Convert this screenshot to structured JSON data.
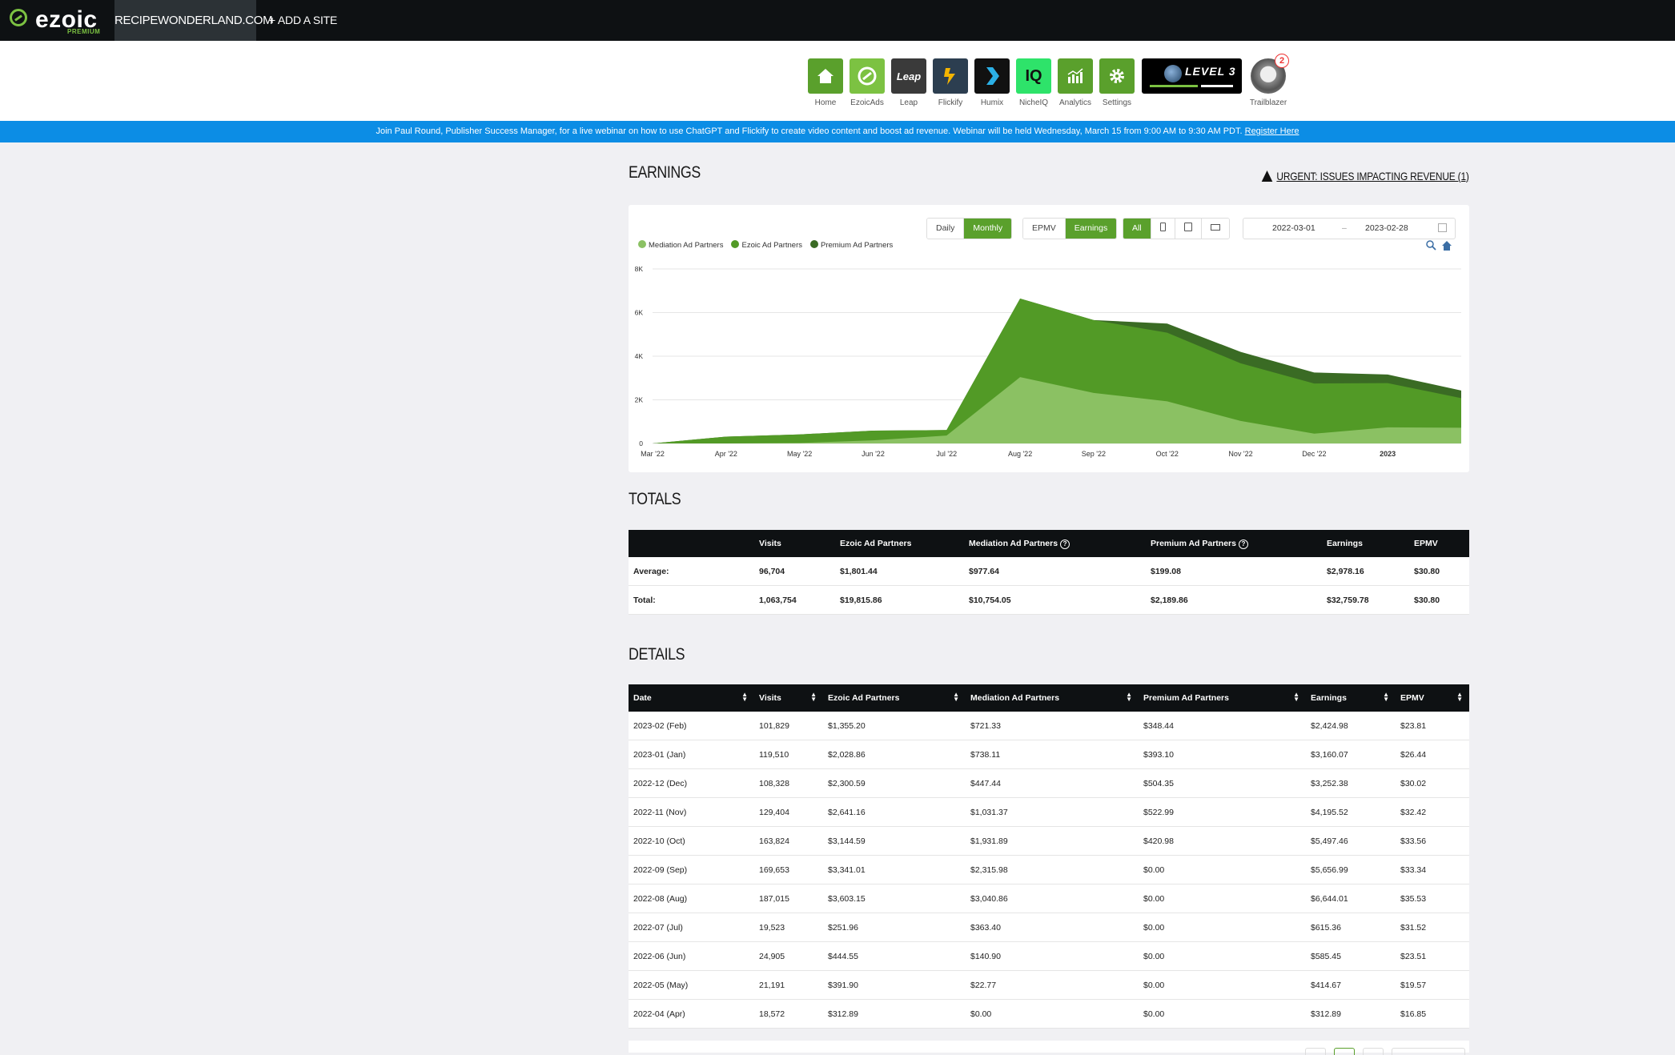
{
  "topbar": {
    "logo_text": "ezoic",
    "logo_tag": "PREMIUM",
    "site": "RECIPEWONDERLAND.COM",
    "add_site": "+ ADD A SITE"
  },
  "apps": [
    {
      "label": "Home",
      "icon": "house-icon",
      "color": "#5aa02c"
    },
    {
      "label": "EzoicAds",
      "icon": "ezoic-ads-icon",
      "color": "#7cc242"
    },
    {
      "label": "Leap",
      "icon": "leap-icon",
      "color": "#3a3a3a",
      "text": "Leap"
    },
    {
      "label": "Flickify",
      "icon": "flickify-icon",
      "color": "#2c3e50"
    },
    {
      "label": "Humix",
      "icon": "humix-icon",
      "color": "#111"
    },
    {
      "label": "NicheIQ",
      "icon": "nicheiq-icon",
      "color": "#2ee36a",
      "text": "IQ"
    },
    {
      "label": "Analytics",
      "icon": "analytics-icon",
      "color": "#5aa02c"
    },
    {
      "label": "Settings",
      "icon": "gear-icon",
      "color": "#5aa02c"
    }
  ],
  "level": "LEVEL 3",
  "trailblazer": {
    "label": "Trailblazer",
    "badge": "2"
  },
  "banner": {
    "text": "Join Paul Round, Publisher Success Manager, for a live webinar on how to use ChatGPT and Flickify to create video content and boost ad revenue. Webinar will be held Wednesday, March 15 from 9:00 AM to 9:30 AM PDT.",
    "link": "Register Here"
  },
  "earnings": {
    "title": "EARNINGS",
    "urgent": "URGENT: ISSUES IMPACTING REVENUE (1)",
    "period_buttons": [
      "Daily",
      "Monthly"
    ],
    "metric_buttons": [
      "EPMV",
      "Earnings"
    ],
    "device_all": "All",
    "date_from": "2022-03-01",
    "date_sep": "–",
    "date_to": "2023-02-28"
  },
  "chart_data": {
    "type": "area",
    "stacked": true,
    "categories": [
      "Mar '22",
      "Apr '22",
      "May '22",
      "Jun '22",
      "Jul '22",
      "Aug '22",
      "Sep '22",
      "Oct '22",
      "Nov '22",
      "Dec '22",
      "2023",
      ""
    ],
    "x_tick_labels": [
      "Mar '22",
      "Apr '22",
      "May '22",
      "Jun '22",
      "Jul '22",
      "Aug '22",
      "Sep '22",
      "Oct '22",
      "Nov '22",
      "Dec '22",
      "2023"
    ],
    "y_ticks": [
      "0",
      "2K",
      "4K",
      "6K",
      "8K"
    ],
    "ylim": [
      0,
      8000
    ],
    "series": [
      {
        "name": "Mediation Ad Partners",
        "color": "#8bc163",
        "values": [
          0,
          0,
          22.77,
          140.9,
          363.4,
          3040.86,
          2315.98,
          1931.89,
          1031.37,
          447.44,
          738.11,
          721.33
        ]
      },
      {
        "name": "Ezoic Ad Partners",
        "color": "#529a26",
        "values": [
          0,
          312.89,
          391.9,
          444.55,
          251.96,
          3603.15,
          3341.01,
          3144.59,
          2641.16,
          2300.59,
          2028.86,
          1355.2
        ]
      },
      {
        "name": "Premium Ad Partners",
        "color": "#3a6b24",
        "values": [
          0,
          0,
          0,
          0,
          0,
          0,
          0,
          420.98,
          522.99,
          504.35,
          393.1,
          348.44
        ]
      }
    ],
    "legend_position": "top-left",
    "grid": true
  },
  "totals": {
    "title": "TOTALS",
    "headers": [
      "",
      "Visits",
      "Ezoic Ad Partners",
      "Mediation Ad Partners",
      "Premium Ad Partners",
      "Earnings",
      "EPMV"
    ],
    "rows": [
      [
        "Average:",
        "96,704",
        "$1,801.44",
        "$977.64",
        "$199.08",
        "$2,978.16",
        "$30.80"
      ],
      [
        "Total:",
        "1,063,754",
        "$19,815.86",
        "$10,754.05",
        "$2,189.86",
        "$32,759.78",
        "$30.80"
      ]
    ]
  },
  "details": {
    "title": "DETAILS",
    "headers": [
      "Date",
      "Visits",
      "Ezoic Ad Partners",
      "Mediation Ad Partners",
      "Premium Ad Partners",
      "Earnings",
      "EPMV"
    ],
    "rows": [
      [
        "2023-02 (Feb)",
        "101,829",
        "$1,355.20",
        "$721.33",
        "$348.44",
        "$2,424.98",
        "$23.81"
      ],
      [
        "2023-01 (Jan)",
        "119,510",
        "$2,028.86",
        "$738.11",
        "$393.10",
        "$3,160.07",
        "$26.44"
      ],
      [
        "2022-12 (Dec)",
        "108,328",
        "$2,300.59",
        "$447.44",
        "$504.35",
        "$3,252.38",
        "$30.02"
      ],
      [
        "2022-11 (Nov)",
        "129,404",
        "$2,641.16",
        "$1,031.37",
        "$522.99",
        "$4,195.52",
        "$32.42"
      ],
      [
        "2022-10 (Oct)",
        "163,824",
        "$3,144.59",
        "$1,931.89",
        "$420.98",
        "$5,497.46",
        "$33.56"
      ],
      [
        "2022-09 (Sep)",
        "169,653",
        "$3,341.01",
        "$2,315.98",
        "$0.00",
        "$5,656.99",
        "$33.34"
      ],
      [
        "2022-08 (Aug)",
        "187,015",
        "$3,603.15",
        "$3,040.86",
        "$0.00",
        "$6,644.01",
        "$35.53"
      ],
      [
        "2022-07 (Jul)",
        "19,523",
        "$251.96",
        "$363.40",
        "$0.00",
        "$615.36",
        "$31.52"
      ],
      [
        "2022-06 (Jun)",
        "24,905",
        "$444.55",
        "$140.90",
        "$0.00",
        "$585.45",
        "$23.51"
      ],
      [
        "2022-05 (May)",
        "21,191",
        "$391.90",
        "$22.77",
        "$0.00",
        "$414.67",
        "$19.57"
      ],
      [
        "2022-04 (Apr)",
        "18,572",
        "$312.89",
        "$0.00",
        "$0.00",
        "$312.89",
        "$16.85"
      ]
    ]
  }
}
